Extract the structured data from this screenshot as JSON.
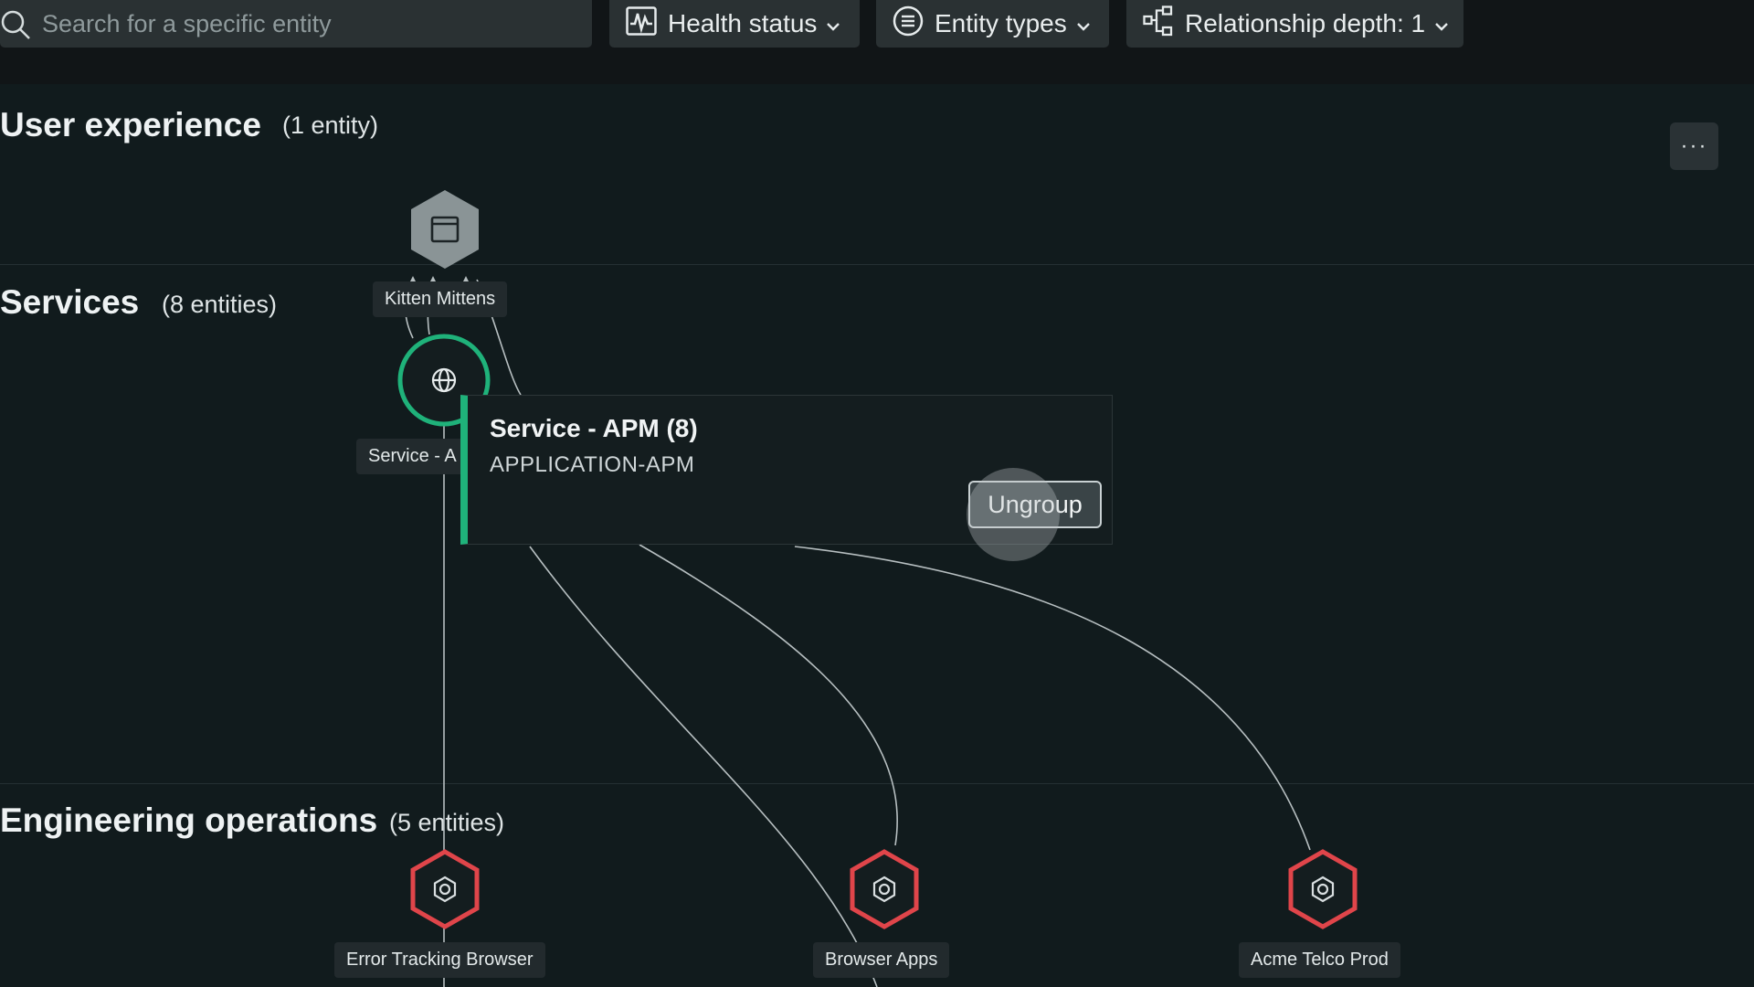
{
  "toolbar": {
    "search_placeholder": "Search for a specific entity",
    "health_label": "Health status",
    "types_label": "Entity types",
    "depth_label": "Relationship depth: 1"
  },
  "sections": {
    "user_experience": {
      "title": "User experience",
      "count": "(1 entity)"
    },
    "services": {
      "title": "Services",
      "count": "(8 entities)"
    },
    "engineering_operations": {
      "title": "Engineering operations",
      "count": "(5 entities)"
    }
  },
  "more_label": "···",
  "nodes": {
    "kitten_mittens": {
      "label": "Kitten Mittens",
      "icon": "browser-window-icon"
    },
    "service_apm": {
      "label": "Service - A",
      "icon": "globe-icon",
      "health": "healthy"
    },
    "error_tracking_browser": {
      "label": "Error Tracking Browser",
      "icon": "gear-icon",
      "health": "critical"
    },
    "browser_apps": {
      "label": "Browser Apps",
      "icon": "gear-icon",
      "health": "critical"
    },
    "acme_telco_prod": {
      "label": "Acme Telco Prod",
      "icon": "gear-icon",
      "health": "critical"
    }
  },
  "tooltip": {
    "title": "Service - APM (8)",
    "subtitle": "APPLICATION-APM",
    "ungroup_label": "Ungroup"
  },
  "colors": {
    "healthy": "#1fb27a",
    "critical": "#e0454a",
    "neutral": "#8a9496"
  }
}
